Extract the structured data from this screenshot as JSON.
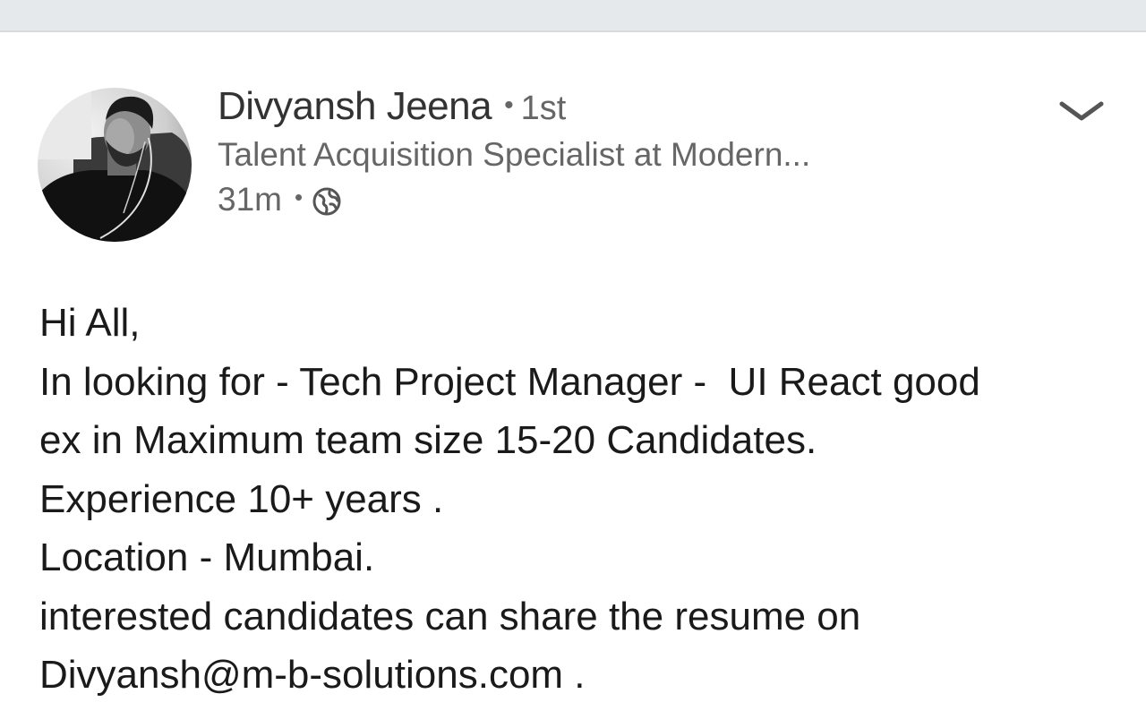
{
  "author": {
    "name": "Divyansh Jeena",
    "separator": "•",
    "degree": "1st",
    "headline": "Talent Acquisition Specialist at Modern...",
    "timestamp": "31m",
    "meta_separator": "•",
    "visibility_icon": "globe-icon",
    "avatar": "profile-photo"
  },
  "menu": {
    "icon": "chevron-down-icon"
  },
  "post": {
    "lines": [
      "Hi All,",
      "In looking for - Tech Project Manager -  UI React good",
      "ex in Maximum team size 15-20 Candidates.",
      "Experience 10+ years .",
      "Location - Mumbai.",
      "interested candidates can share the resume on",
      "Divyansh@m-b-solutions.com ."
    ]
  },
  "colors": {
    "topbar": "#e6e9ec",
    "name": "#333333",
    "secondary_text": "#666666",
    "body_text": "#1a1a1a"
  }
}
